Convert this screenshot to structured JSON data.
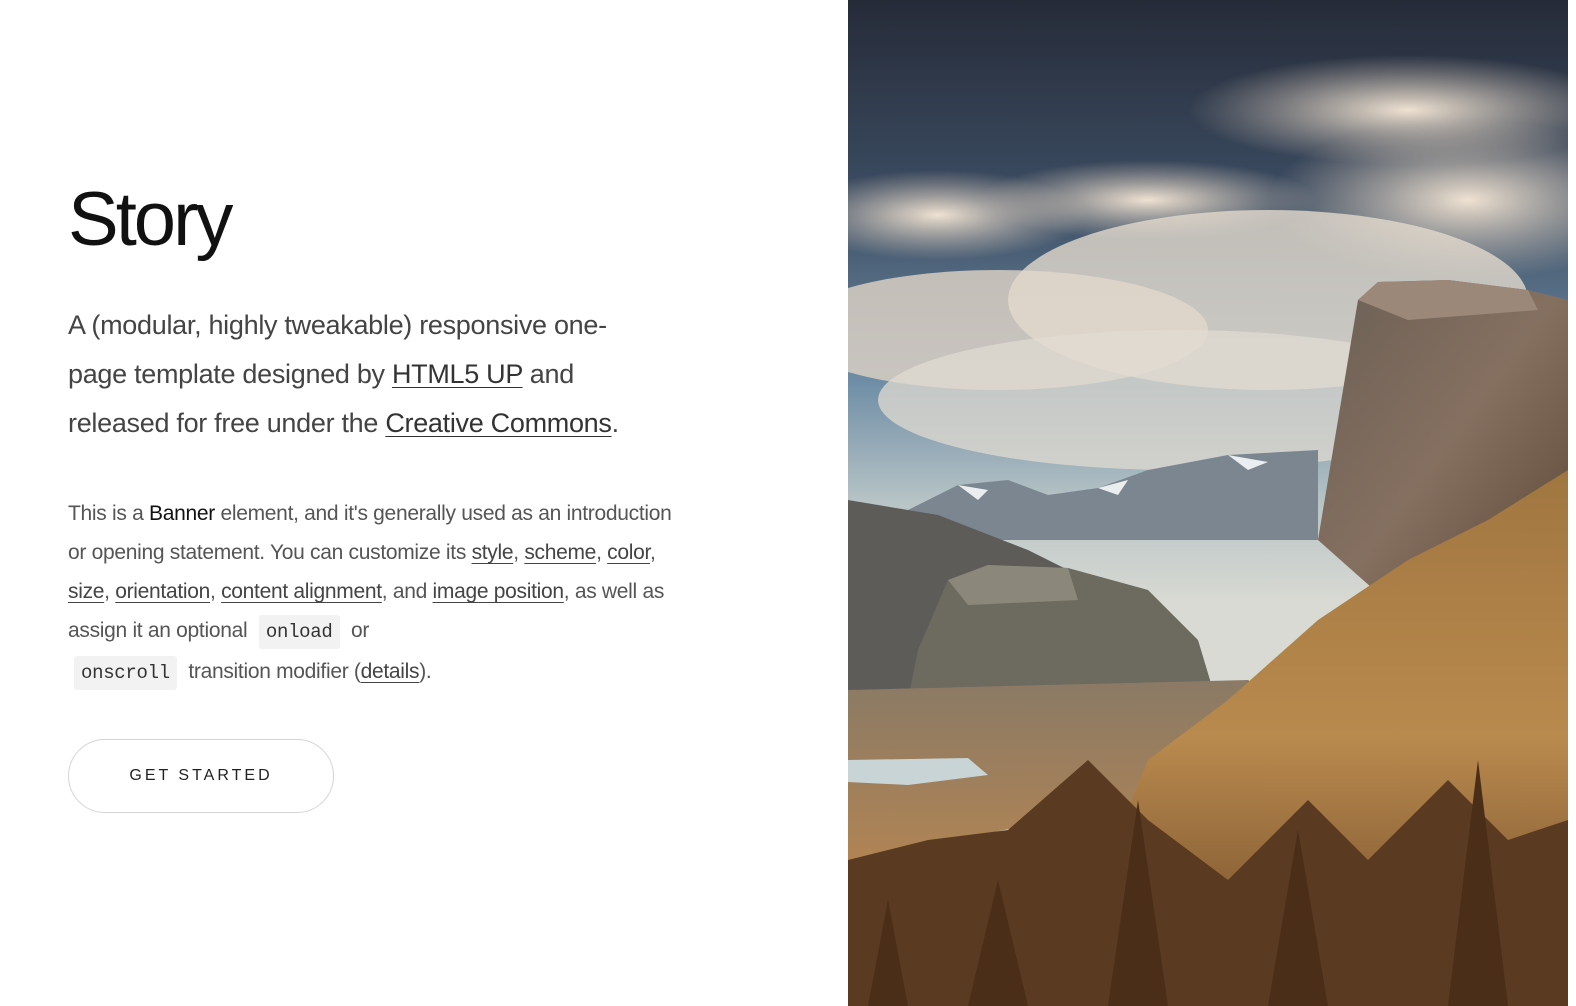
{
  "banner": {
    "title": "Story",
    "lead": {
      "part1": "A (modular, highly tweakable) responsive one-page template designed by ",
      "link1": "HTML5 UP",
      "part2": " and released for free under the ",
      "link2": "Creative Commons",
      "part3": "."
    },
    "body": {
      "t1": "This is a ",
      "strong": "Banner",
      "t2": " element, and it's generally used as an introduction or opening statement. You can customize its ",
      "link_style": "style",
      "sep1": ", ",
      "link_scheme": "scheme",
      "sep2": ", ",
      "link_color": "color",
      "sep3": ", ",
      "link_size": "size",
      "sep4": ", ",
      "link_orientation": "orientation",
      "sep5": ", ",
      "link_alignment": "content alignment",
      "t3": ", and ",
      "link_image_position": "image position",
      "t4": ", as well as assign it an optional ",
      "code_onload": "onload",
      "t5": " or ",
      "code_onscroll": "onscroll",
      "t6": " transition modifier (",
      "link_details": "details",
      "t7": ")."
    },
    "button_label": "GET STARTED"
  },
  "image": {
    "icon": "landscape-photo",
    "colors": {
      "sky_top": "#2a2f3d",
      "sky_mid": "#5d7a95",
      "cloud": "#e8d8c8",
      "mountain": "#6b5a48",
      "slope": "#b07c45",
      "forest": "#5a3a20"
    }
  }
}
